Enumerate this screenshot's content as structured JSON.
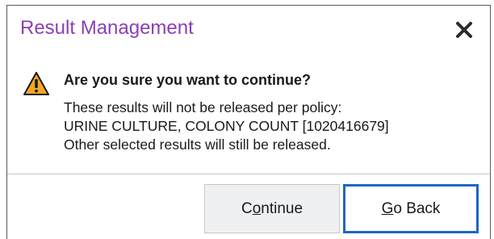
{
  "dialog": {
    "title": "Result Management",
    "close_icon": "close-icon",
    "warning_icon": "warning-icon",
    "question": "Are you sure you want to continue?",
    "message_lines": [
      "These results will not be released per policy:",
      "URINE CULTURE, COLONY COUNT [1020416679]",
      "Other selected results will still be released."
    ]
  },
  "buttons": {
    "continue": {
      "pre": "C",
      "mnemonic": "o",
      "post": "ntinue"
    },
    "go_back": {
      "pre": "",
      "mnemonic": "G",
      "post": "o Back"
    }
  },
  "colors": {
    "title": "#8b3fb3",
    "focus_border": "#1f66c4",
    "warning": "#f5a623"
  }
}
